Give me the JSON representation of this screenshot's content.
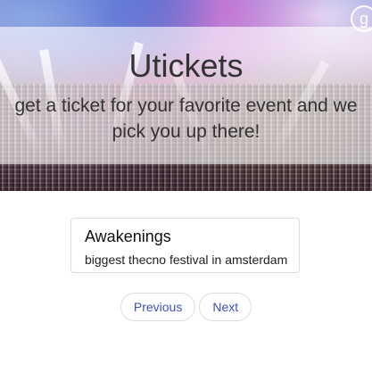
{
  "hero": {
    "title": "Utickets",
    "subtitle": "get a ticket for your favorite event and we pick you up there!",
    "avatar_icon": "user-avatar-icon",
    "avatar_glyph": "g"
  },
  "events": [
    {
      "title": "Awakenings",
      "description": "biggest thecno festival in amsterdam"
    }
  ],
  "pagination": {
    "previous_label": "Previous",
    "next_label": "Next"
  },
  "colors": {
    "link": "#3f51b5",
    "overlay": "rgba(255,255,255,0.62)",
    "card_border": "#dcdcdc"
  }
}
